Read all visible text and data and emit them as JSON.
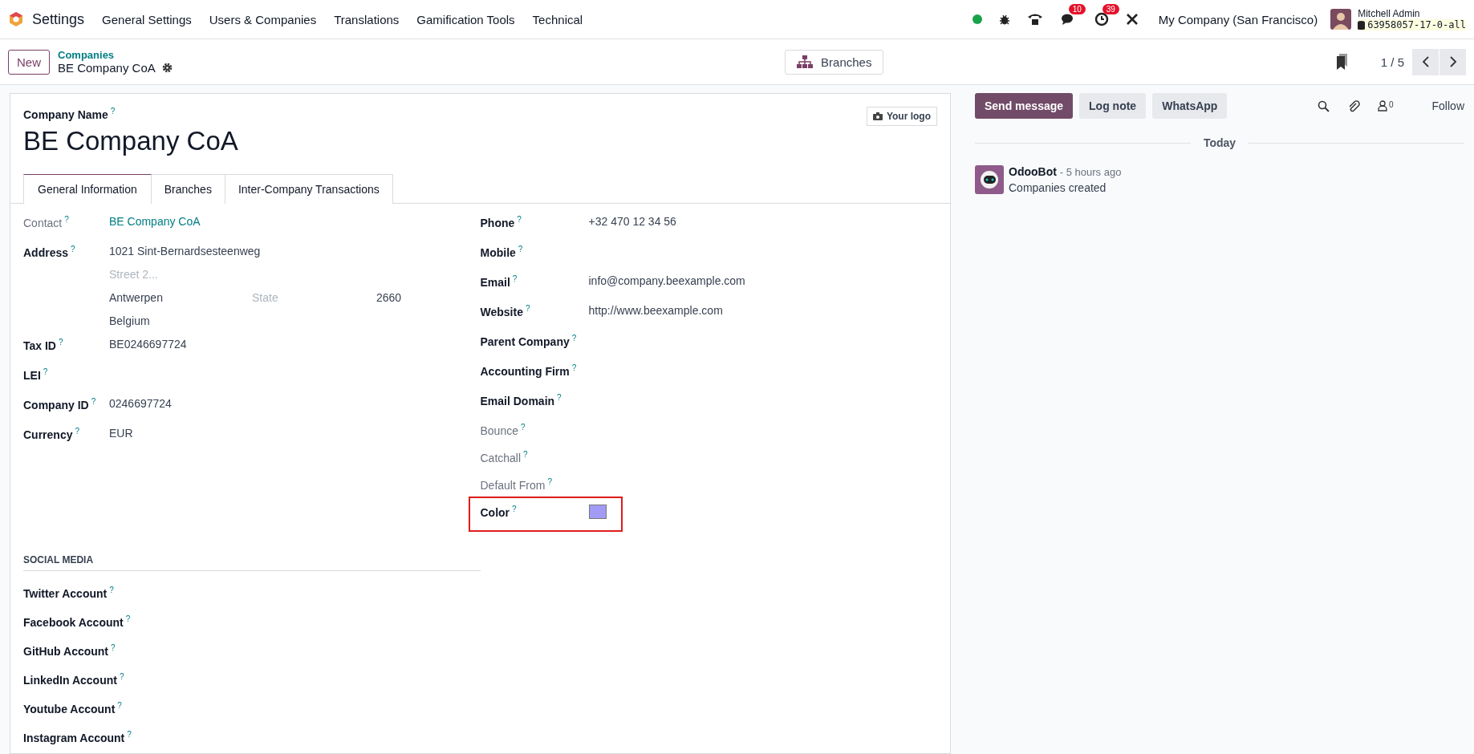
{
  "navbar": {
    "app_title": "Settings",
    "menus": [
      "General Settings",
      "Users & Companies",
      "Translations",
      "Gamification Tools",
      "Technical"
    ],
    "chat_badge": "10",
    "activity_badge": "39",
    "company": "My Company (San Francisco)",
    "user_name": "Mitchell Admin",
    "database": "63958057-17-0-all"
  },
  "control_panel": {
    "new_button": "New",
    "breadcrumb_parent": "Companies",
    "breadcrumb_current": "BE Company CoA",
    "branches_button": "Branches",
    "pager": "1 / 5"
  },
  "form": {
    "name_label": "Company Name",
    "name_help": "?",
    "name": "BE Company CoA",
    "logo_button": "Your logo",
    "tabs": [
      {
        "label": "General Information",
        "selected": true
      },
      {
        "label": "Branches",
        "selected": false
      },
      {
        "label": "Inter-Company Transactions",
        "selected": false
      }
    ],
    "left_fields": [
      {
        "kind": "link",
        "label": "Contact",
        "help": "?",
        "muted": true,
        "value": "BE Company CoA"
      },
      {
        "kind": "address",
        "label": "Address",
        "help": "?",
        "muted": false,
        "street": "1021 Sint-Bernardsesteenweg",
        "street2_placeholder": "Street 2...",
        "city": "Antwerpen",
        "state_placeholder": "State",
        "zip": "2660",
        "country": "Belgium"
      },
      {
        "kind": "text",
        "label": "Tax ID",
        "help": "?",
        "muted": false,
        "value": "BE0246697724"
      },
      {
        "kind": "text",
        "label": "LEI",
        "help": "?",
        "muted": false
      },
      {
        "kind": "text",
        "label": "Company ID",
        "help": "?",
        "muted": false,
        "value": "0246697724"
      },
      {
        "kind": "text",
        "label": "Currency",
        "help": "?",
        "muted": false,
        "value": "EUR"
      }
    ],
    "right_fields": [
      {
        "kind": "text",
        "label": "Phone",
        "help": "?",
        "muted": false,
        "value": "+32 470 12 34 56"
      },
      {
        "kind": "text",
        "label": "Mobile",
        "help": "?",
        "muted": false
      },
      {
        "kind": "text",
        "label": "Email",
        "help": "?",
        "muted": false,
        "value": "info@company.beexample.com"
      },
      {
        "kind": "text",
        "label": "Website",
        "help": "?",
        "muted": false,
        "value": "http://www.beexample.com"
      },
      {
        "kind": "text",
        "label": "Parent Company",
        "help": "?",
        "muted": false
      },
      {
        "kind": "text",
        "label": "Accounting Firm",
        "help": "?",
        "muted": false
      },
      {
        "kind": "text",
        "label": "Email Domain",
        "help": "?",
        "muted": false
      },
      {
        "kind": "text",
        "label": "Bounce",
        "help": "?",
        "muted": true
      },
      {
        "kind": "text",
        "label": "Catchall",
        "help": "?",
        "muted": true
      },
      {
        "kind": "text",
        "label": "Default From",
        "help": "?",
        "muted": true
      },
      {
        "kind": "color",
        "label": "Color",
        "help": "?",
        "muted": false,
        "color": "#a29bf6",
        "highlighted": true
      }
    ],
    "social_title": "SOCIAL MEDIA",
    "social_fields": [
      {
        "label": "Twitter Account",
        "help": "?"
      },
      {
        "label": "Facebook Account",
        "help": "?"
      },
      {
        "label": "GitHub Account",
        "help": "?"
      },
      {
        "label": "LinkedIn Account",
        "help": "?"
      },
      {
        "label": "Youtube Account",
        "help": "?"
      },
      {
        "label": "Instagram Account",
        "help": "?"
      }
    ]
  },
  "chatter": {
    "buttons": [
      {
        "label": "Send message",
        "primary": true
      },
      {
        "label": "Log note",
        "primary": false
      },
      {
        "label": "WhatsApp",
        "primary": false
      }
    ],
    "follower_count": "0",
    "follow": "Follow",
    "date_separator": "Today",
    "messages": [
      {
        "author": "OdooBot",
        "time": "- 5 hours ago",
        "body": "Companies created"
      }
    ]
  }
}
